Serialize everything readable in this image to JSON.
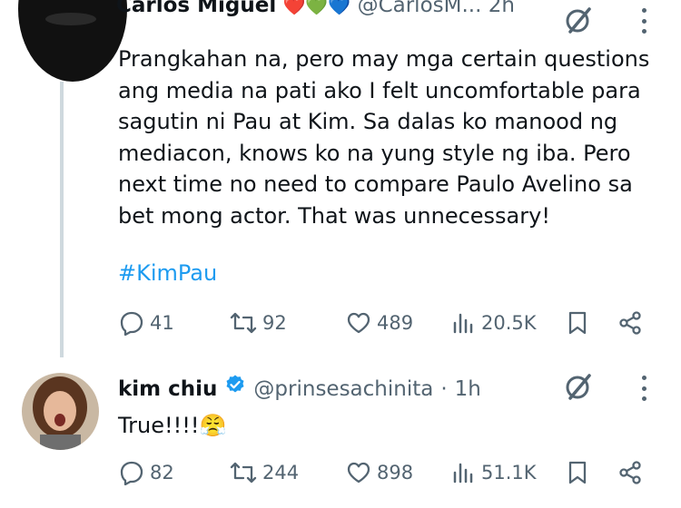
{
  "top_tweet": {
    "name": "Carlos Miguel",
    "hearts": "❤️💚💙",
    "handle": "@CarlosM...",
    "time": "2h",
    "text": "Prangkahan na, pero may mga certain questions ang media na pati ako I felt uncomfortable para sagutin ni Pau at Kim. Sa dalas ko manood ng mediacon, knows ko na yung style ng iba. Pero next time no need to compare Paulo Avelino sa bet mong actor. That was unnecessary!",
    "hashtag": "#KimPau",
    "replies": "41",
    "reposts": "92",
    "likes": "489",
    "views": "20.5K"
  },
  "reply_tweet": {
    "name": "kim chiu",
    "handle": "@prinsesachinita",
    "separator": "·",
    "time": "1h",
    "text": "True!!!!😤",
    "replies": "82",
    "reposts": "244",
    "likes": "898",
    "views": "51.1K"
  },
  "icons": [
    "reply-icon",
    "repost-icon",
    "like-icon",
    "views-icon",
    "bookmark-icon",
    "share-icon",
    "grok-icon",
    "more-icon",
    "verified-badge-icon"
  ],
  "colors": {
    "hashtag": "#1d9bf0",
    "verified": "#1d9bf0",
    "muted": "#536471",
    "thread_line": "#cfd9de"
  }
}
